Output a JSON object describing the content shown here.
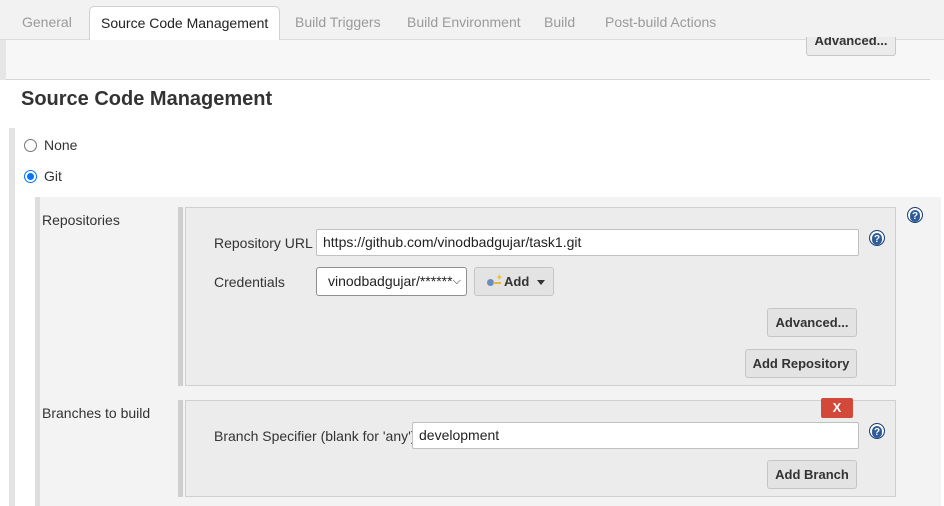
{
  "tabs": [
    {
      "label": "General"
    },
    {
      "label": "Source Code Management",
      "active": true
    },
    {
      "label": "Build Triggers"
    },
    {
      "label": "Build Environment"
    },
    {
      "label": "Build"
    },
    {
      "label": "Post-build Actions"
    }
  ],
  "top_advanced_label": "Advanced...",
  "section_title": "Source Code Management",
  "scm_options": {
    "none_label": "None",
    "git_label": "Git",
    "selected": "Git"
  },
  "repositories": {
    "label": "Repositories",
    "repo_url_label": "Repository URL",
    "repo_url_value": "https://github.com/vinodbadgujar/task1.git",
    "credentials_label": "Credentials",
    "credentials_selected": "vinodbadgujar/******",
    "add_label": "Add",
    "advanced_label": "Advanced...",
    "add_repository_label": "Add Repository"
  },
  "branches": {
    "label": "Branches to build",
    "delete_label": "X",
    "specifier_label": "Branch Specifier (blank for 'any')",
    "specifier_value": "development",
    "add_branch_label": "Add Branch"
  },
  "help_glyph": "?",
  "colors": {
    "help_icon": "#2d5c9a",
    "delete_button": "#d24939",
    "radio_checked": "#0075ff"
  }
}
